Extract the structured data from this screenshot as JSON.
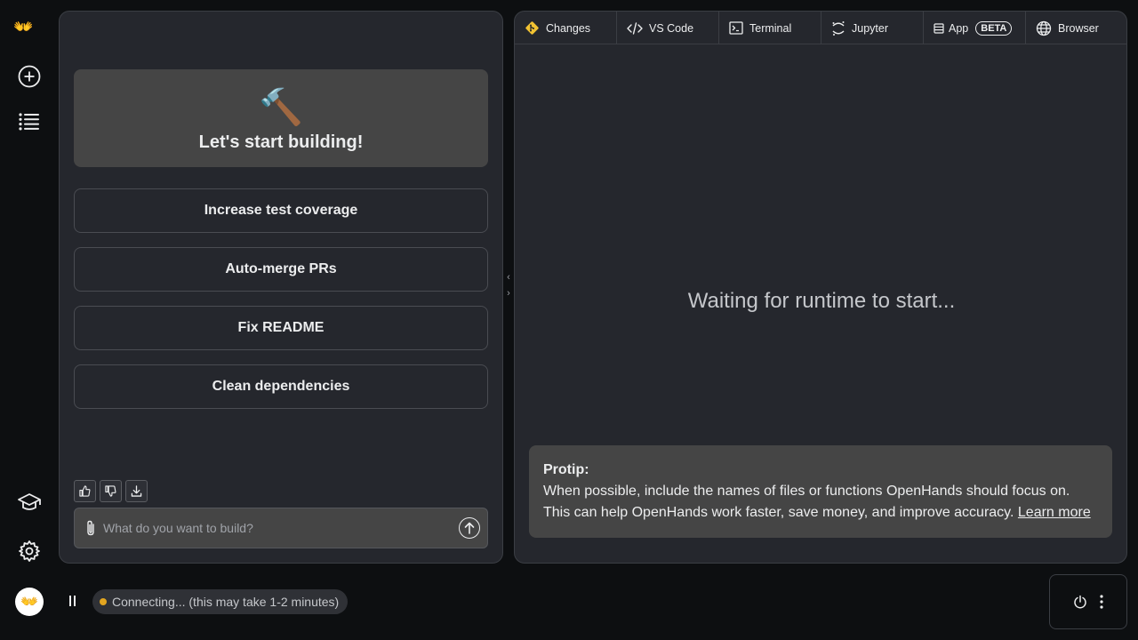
{
  "sidebar": {
    "logo": "👐",
    "user_avatar": "👐"
  },
  "chat": {
    "hero_emoji": "🔨",
    "hero_title": "Let's start building!",
    "suggestions": [
      "Increase test coverage",
      "Auto-merge PRs",
      "Fix README",
      "Clean dependencies"
    ],
    "input_placeholder": "What do you want to build?"
  },
  "workspace": {
    "tabs": [
      {
        "label": "Changes",
        "icon": "git-icon"
      },
      {
        "label": "VS Code",
        "icon": "code-icon"
      },
      {
        "label": "Terminal",
        "icon": "terminal-icon"
      },
      {
        "label": "Jupyter",
        "icon": "jupyter-icon"
      },
      {
        "label": "App",
        "icon": "app-icon",
        "badge": "BETA"
      },
      {
        "label": "Browser",
        "icon": "globe-icon"
      }
    ],
    "waiting_text": "Waiting for runtime to start...",
    "protip": {
      "title": "Protip:",
      "line1": "When possible, include the names of files or functions OpenHands should focus on.",
      "line2": "This can help OpenHands work faster, save money, and improve accuracy.",
      "link": "Learn more"
    }
  },
  "status": {
    "text": "Connecting... (this may take 1-2 minutes)",
    "color": "#e2a520"
  },
  "colors": {
    "background": "#0d0f11",
    "panel": "#25272d",
    "card": "#454545",
    "border": "#3b3e44",
    "text": "#ECEDEE",
    "git_accent": "#f1c232"
  }
}
